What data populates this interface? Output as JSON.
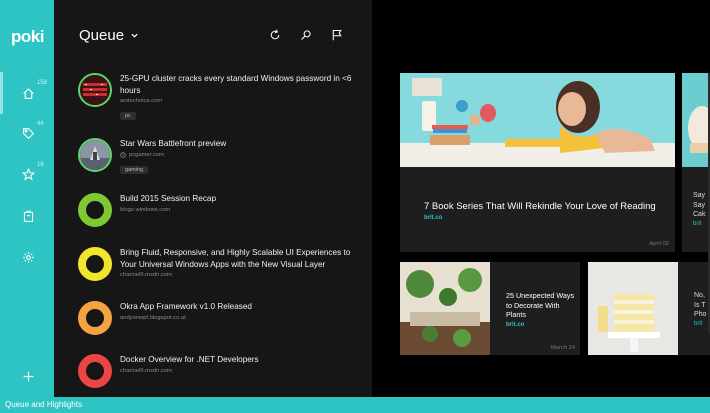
{
  "app": {
    "logo": "poki"
  },
  "rail": {
    "items": [
      {
        "icon": "home-icon",
        "count": "158"
      },
      {
        "icon": "tag-icon",
        "count": "44"
      },
      {
        "icon": "star-icon",
        "count": "16"
      },
      {
        "icon": "archive-icon",
        "count": ""
      },
      {
        "icon": "gear-icon",
        "count": ""
      },
      {
        "icon": "plus-icon",
        "count": ""
      }
    ]
  },
  "queue": {
    "title": "Queue",
    "items": [
      {
        "title": "25-GPU cluster cracks every standard Windows password in <6 hours",
        "source": "arstechnica.com",
        "tag": "pc",
        "thumb": "image"
      },
      {
        "title": "Star Wars Battlefront preview",
        "source": "pcgamer.com",
        "tag": "gaming",
        "thumb": "image"
      },
      {
        "title": "Build 2015 Session Recap",
        "source": "blogs.windows.com",
        "tag": "",
        "thumb": "ring",
        "color": "#7fc832"
      },
      {
        "title": "Bring Fluid, Responsive, and Highly Scalable UI Experiences to Your Universal Windows Apps with the New Visual Layer",
        "source": "channel9.msdn.com",
        "tag": "",
        "thumb": "ring",
        "color": "#f2e52e"
      },
      {
        "title": "Okra App Framework v1.0 Released",
        "source": "andyonwpf.blogspot.co.at",
        "tag": "",
        "thumb": "ring",
        "color": "#f5a340"
      },
      {
        "title": "Docker Overview for .NET Developers",
        "source": "channel9.msdn.com",
        "tag": "",
        "thumb": "ring",
        "color": "#ec4545"
      }
    ]
  },
  "highlights": {
    "featured": {
      "title": "7 Book Series That Will Rekindle Your Love of Reading",
      "source": "brit.co",
      "date": "April 02"
    },
    "second": {
      "title": "25 Unexpected Ways to Decorate With Plants",
      "source": "brit.co",
      "date": "March 24"
    },
    "peek_top": {
      "lines": [
        "I",
        "Say",
        "Say",
        "Cak",
        "brit"
      ]
    },
    "peek_bottom": {
      "lines": [
        "No,",
        "Is T",
        "Pho",
        "brit"
      ]
    }
  },
  "status": {
    "text": "Queue and Highlights"
  },
  "colors": {
    "accent": "#2ec4c4"
  }
}
